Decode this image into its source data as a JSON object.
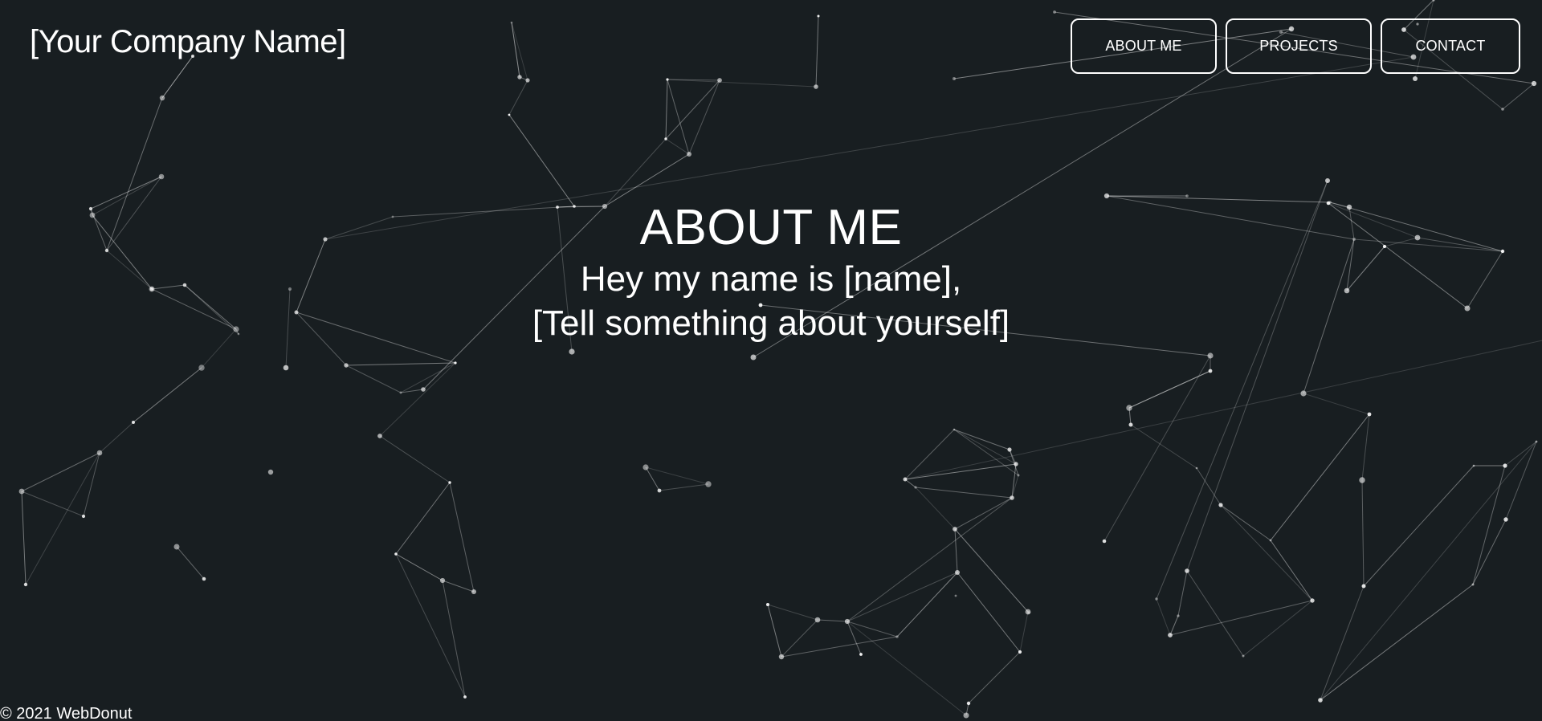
{
  "header": {
    "brand": "[Your Company Name]",
    "nav": [
      {
        "label": "ABOUT ME"
      },
      {
        "label": "PROJECTS"
      },
      {
        "label": "CONTACT"
      }
    ]
  },
  "hero": {
    "title": "ABOUT ME",
    "line1": "Hey my name is [name],",
    "line2": "[Tell something about yourself]"
  },
  "footer": {
    "copyright": "© 2021 WebDonut"
  },
  "theme": {
    "background": "#181e21",
    "foreground": "#ffffff"
  }
}
